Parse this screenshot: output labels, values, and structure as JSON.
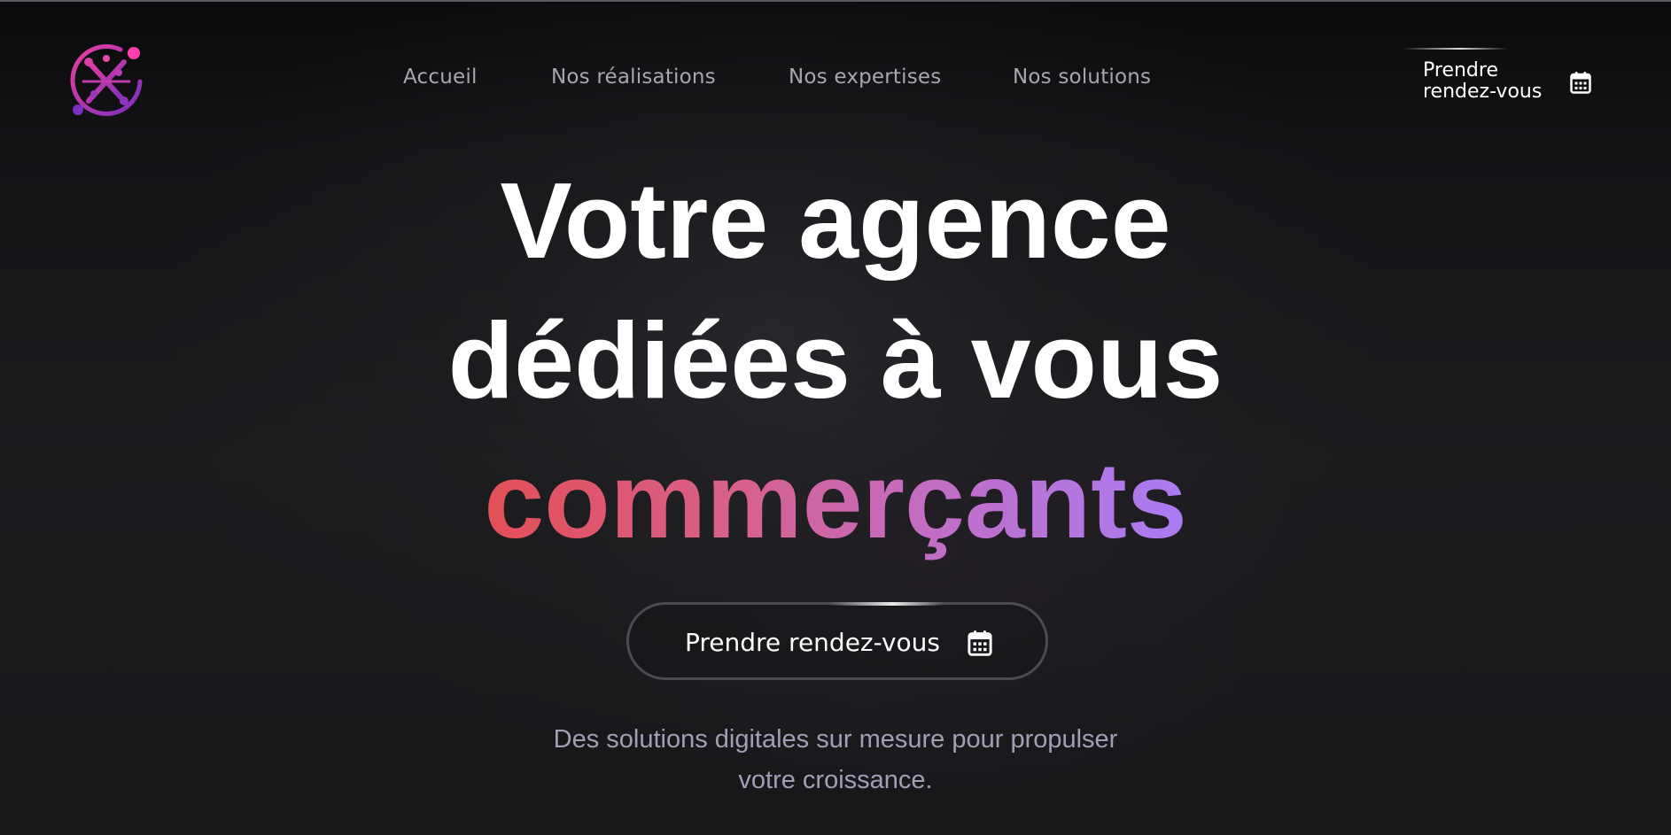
{
  "header": {
    "logo_icon": "x-network-logo-icon",
    "nav": [
      {
        "label": "Accueil"
      },
      {
        "label": "Nos réalisations"
      },
      {
        "label": "Nos expertises"
      },
      {
        "label": "Nos solutions"
      }
    ],
    "cta": {
      "label_line1": "Prendre",
      "label_line2": "rendez-vous",
      "icon": "calendar-icon"
    }
  },
  "hero": {
    "title_line1": "Votre agence",
    "title_line2": "dédiées à vous",
    "title_highlight": "commerçants",
    "cta": {
      "label": "Prendre rendez-vous",
      "icon": "calendar-icon"
    },
    "subtitle_line1": "Des solutions digitales sur mesure pour propulser",
    "subtitle_line2": "votre croissance."
  },
  "colors": {
    "background": "#111114",
    "nav_text": "#a7a7ac",
    "subtitle_text": "#a29fb4",
    "gradient_start": "#e34f56",
    "gradient_end": "#a97cf4",
    "logo_pink": "#e83ea0",
    "logo_purple": "#7b2fbf"
  }
}
